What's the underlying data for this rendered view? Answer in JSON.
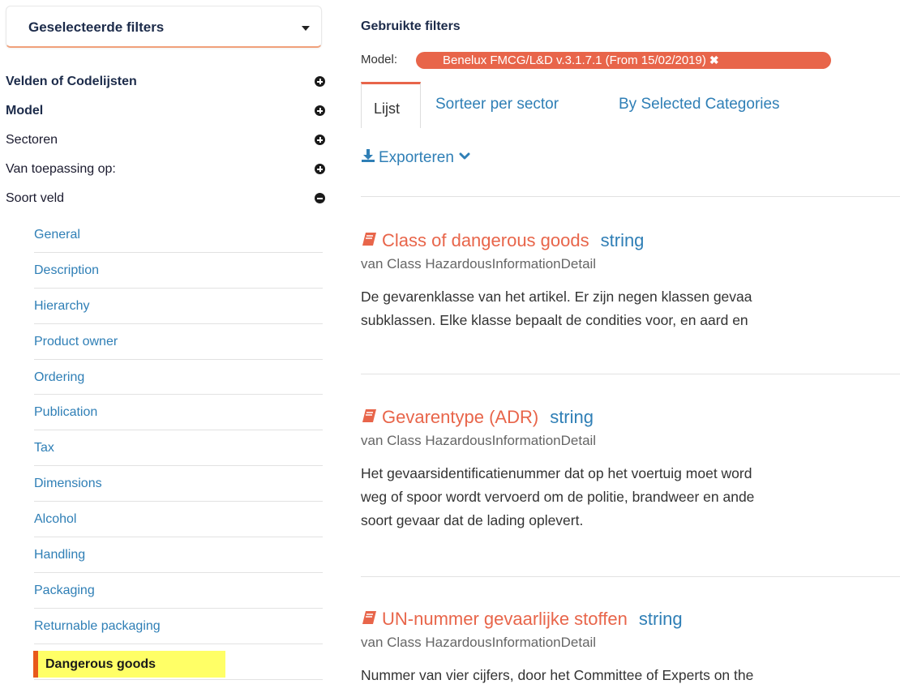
{
  "sidebar": {
    "filter_box_title": "Geselecteerde filters",
    "categories": [
      {
        "label": "Velden of Codelijsten",
        "bold": true,
        "state": "plus"
      },
      {
        "label": "Model",
        "bold": true,
        "state": "plus"
      },
      {
        "label": "Sectoren",
        "bold": false,
        "state": "plus"
      },
      {
        "label": "Van toepassing op:",
        "bold": false,
        "state": "plus"
      },
      {
        "label": "Soort veld",
        "bold": false,
        "state": "minus"
      }
    ],
    "field_types": [
      "General",
      "Description",
      "Hierarchy",
      "Product owner",
      "Ordering",
      "Publication",
      "Tax",
      "Dimensions",
      "Alcohol",
      "Handling",
      "Packaging",
      "Returnable packaging"
    ],
    "active_field_type": "Dangerous goods"
  },
  "main": {
    "used_filters_title": "Gebruikte filters",
    "model_label": "Model:",
    "model_value": "Benelux FMCG/L&D v.3.1.7.1 (From 15/02/2019)",
    "tabs": [
      "Lijst",
      "Sorteer per sector",
      "By Selected Categories"
    ],
    "export_label": "Exporteren",
    "entries": [
      {
        "name": "Class of dangerous goods",
        "type": "string",
        "class": "van Class HazardousInformationDetail",
        "desc": [
          "De gevarenklasse van het artikel. Er zijn negen klassen gevaa",
          "subklassen. Elke klasse bepaalt de condities voor, en aard en"
        ]
      },
      {
        "name": "Gevarentype (ADR)",
        "type": "string",
        "class": "van Class HazardousInformationDetail",
        "desc": [
          "Het gevaarsidentificatienummer dat op het voertuig moet word",
          "weg of spoor wordt vervoerd om de politie, brandweer en ande",
          "soort gevaar dat de lading oplevert."
        ]
      },
      {
        "name": "UN-nummer gevaarlijke stoffen",
        "type": "string",
        "class": "van Class HazardousInformationDetail",
        "desc": [
          "Nummer van vier cijfers, door het Committee of Experts on the"
        ]
      }
    ]
  },
  "colors": {
    "accent": "#e8654a",
    "link": "#2f7fb6",
    "highlight": "#ffff66",
    "highlight_bar": "#e8591a",
    "heading": "#1c2b4a"
  },
  "icons": {
    "caret": "caret-down-icon",
    "expand": "plus-circle-icon",
    "collapse": "minus-circle-icon",
    "remove": "close-icon",
    "export": "download-icon",
    "export_menu": "chevron-down-icon",
    "entry": "book-icon"
  }
}
